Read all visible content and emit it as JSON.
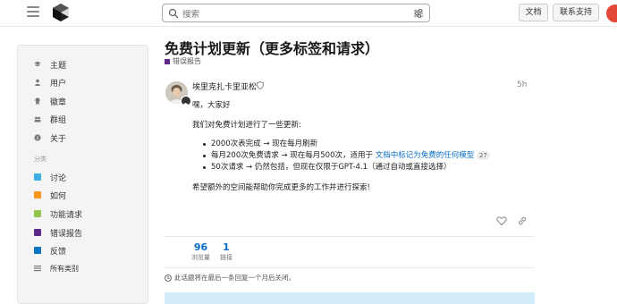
{
  "header": {
    "search_placeholder": "搜索",
    "docs_label": "文档",
    "support_label": "联系支持"
  },
  "sidebar": {
    "items": [
      {
        "label": "主题",
        "icon": "layers-icon"
      },
      {
        "label": "用户",
        "icon": "users-icon"
      },
      {
        "label": "徽章",
        "icon": "badge-icon"
      },
      {
        "label": "群组",
        "icon": "group-icon"
      },
      {
        "label": "关于",
        "icon": "info-icon"
      }
    ],
    "categories_heading": "分类",
    "categories": [
      {
        "label": "讨论",
        "color": "#3ab0e2"
      },
      {
        "label": "如何",
        "color": "#f7941d"
      },
      {
        "label": "功能请求",
        "color": "#92c44b"
      },
      {
        "label": "错误报告",
        "color": "#5d2a88"
      },
      {
        "label": "反馈",
        "color": "#0e76bd"
      }
    ],
    "all_categories_label": "所有类别"
  },
  "topic": {
    "title": "免费计划更新（更多标签和请求）",
    "category": "错误报告",
    "category_color": "#5d2a88"
  },
  "post": {
    "username": "埃里克扎卡里亚松",
    "time": "5h",
    "greeting": "嘿，大家好",
    "intro": "我们对免费计划进行了一些更新:",
    "bullets": [
      {
        "text": "2000次表完成 → 现在每月刷新"
      },
      {
        "text": "每月200次免费请求 → 现在每月500次，适用于 ",
        "link": "文档中标记为免费的任何模型",
        "count": "27"
      },
      {
        "text": "50次请求 → 仍然包括，但现在仅限于GPT-4.1（通过自动或直接选择）"
      }
    ],
    "closing": "希望额外的空间能帮助你完成更多的工作并进行探索!"
  },
  "stats": {
    "views_num": "96",
    "views_label": "浏览量",
    "links_num": "1",
    "links_label": "链接"
  },
  "closed_notice": "此话题将在最后一条回复一个月后关闭。"
}
